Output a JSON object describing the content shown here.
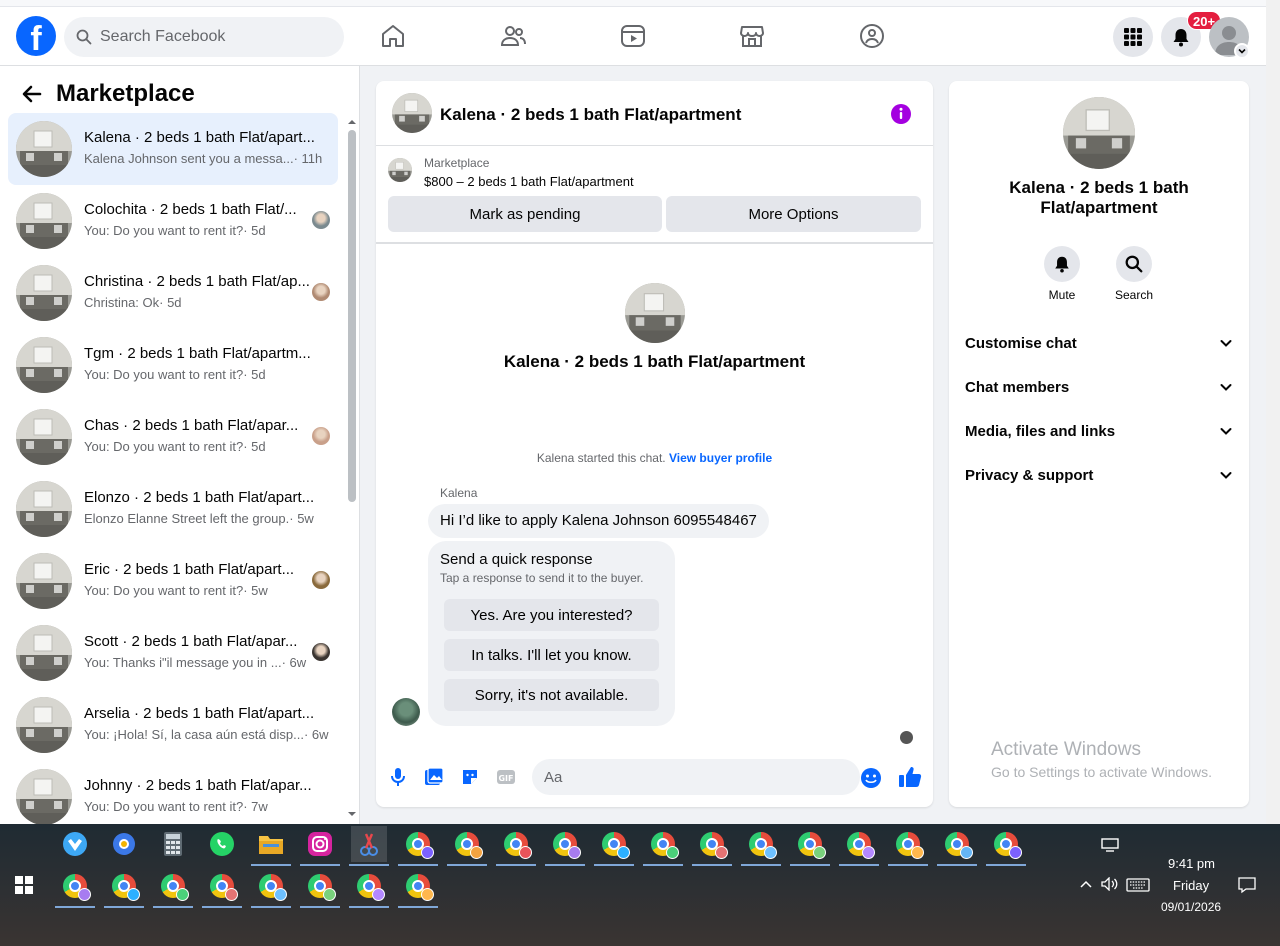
{
  "nav": {
    "logo": "f",
    "search_placeholder": "Search Facebook",
    "notification_count": "20+"
  },
  "sidebar": {
    "title": "Marketplace",
    "chats": [
      {
        "title": "Kalena · 2 beds 1 bath Flat/apart...",
        "preview": "Kalena Johnson sent you a messa...",
        "time": "· 11h",
        "active": true
      },
      {
        "title": "Colochita · 2 beds 1 bath Flat/...",
        "preview": "You: Do you want to rent it?",
        "time": "· 5d"
      },
      {
        "title": "Christina · 2 beds 1 bath Flat/ap...",
        "preview": "Christina: Ok",
        "time": "· 5d"
      },
      {
        "title": "Tgm · 2 beds 1 bath Flat/apartm...",
        "preview": "You: Do you want to rent it?",
        "time": "· 5d"
      },
      {
        "title": "Chas · 2 beds 1 bath Flat/apar...",
        "preview": "You: Do you want to rent it?",
        "time": "· 5d"
      },
      {
        "title": "Elonzo · 2 beds 1 bath Flat/apart...",
        "preview": "Elonzo Elanne Street left the group.",
        "time": "· 5w"
      },
      {
        "title": "Eric · 2 beds 1 bath Flat/apart...",
        "preview": "You: Do you want to rent it?",
        "time": "· 5w"
      },
      {
        "title": "Scott · 2 beds 1 bath Flat/apar...",
        "preview": "You: Thanks i\"il message you in ...",
        "time": "· 6w"
      },
      {
        "title": "Arselia · 2 beds 1 bath Flat/apart...",
        "preview": "You: ¡Hola! Sí, la casa aún está disp...",
        "time": "· 6w"
      },
      {
        "title": "Johnny · 2 beds 1 bath Flat/apar...",
        "preview": "You: Do you want to rent it?",
        "time": "· 7w"
      }
    ]
  },
  "chat": {
    "header_title": "Kalena · 2 beds 1 bath Flat/apartment",
    "marketplace_label": "Marketplace",
    "listing": "$800 – 2 beds 1 bath Flat/apartment",
    "mark_pending": "Mark as pending",
    "more_options": "More Options",
    "intro_title": "Kalena · 2 beds 1 bath Flat/apartment",
    "started_text": "Kalena started this chat.",
    "view_profile": "View buyer profile",
    "sender": "Kalena",
    "message": "Hi I’d like to apply Kalena Johnson 6095548467",
    "quick_title": "Send a quick response",
    "quick_sub": "Tap a response to send it to the buyer.",
    "quick_replies": [
      "Yes. Are you interested?",
      "In talks. I'll let you know.",
      "Sorry, it's not available."
    ],
    "input_placeholder": "Aa"
  },
  "details": {
    "title": "Kalena · 2 beds 1 bath Flat/apartment",
    "mute": "Mute",
    "search": "Search",
    "sections": [
      "Customise chat",
      "Chat members",
      "Media, files and links",
      "Privacy & support"
    ]
  },
  "watermark": {
    "line1": "Activate Windows",
    "line2": "Go to Settings to activate Windows."
  },
  "taskbar": {
    "time": "9:41 pm",
    "day": "Friday",
    "date": "09/01/2026"
  },
  "colors": {
    "brand": "#0866ff",
    "badge": "#e41e3f",
    "info": "#a400e0"
  }
}
